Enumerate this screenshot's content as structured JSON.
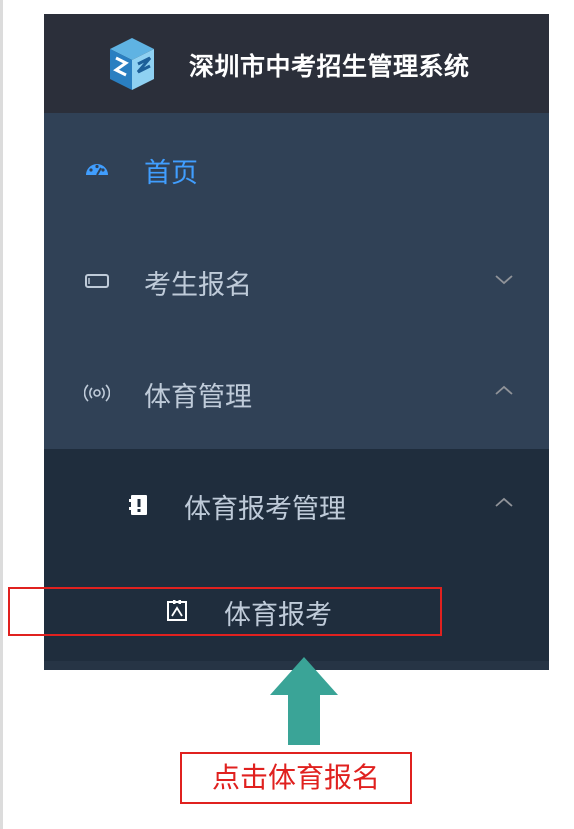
{
  "app": {
    "title": "深圳市中考招生管理系统",
    "logo_icon": "cube-stack-logo-icon"
  },
  "menu": {
    "items": [
      {
        "label": "首页",
        "icon": "dashboard-icon",
        "active": true
      },
      {
        "label": "考生报名",
        "icon": "rectangle-icon",
        "expanded": false
      },
      {
        "label": "体育管理",
        "icon": "broadcast-icon",
        "expanded": true
      }
    ],
    "submenu": {
      "label": "体育报考管理",
      "icon": "exclamation-box-icon",
      "expanded": true,
      "children": [
        {
          "label": "体育报考",
          "icon": "frame-box-icon"
        }
      ]
    }
  },
  "annotation": {
    "callout_text": "点击体育报名",
    "box_color": "#e0211f",
    "arrow_color": "#3aa497"
  },
  "colors": {
    "sidebar_bg": "#304156",
    "header_bg": "#2b2f3a",
    "submenu_bg": "#1f2d3d",
    "active_text": "#409eff",
    "text": "#bfcbd9"
  }
}
